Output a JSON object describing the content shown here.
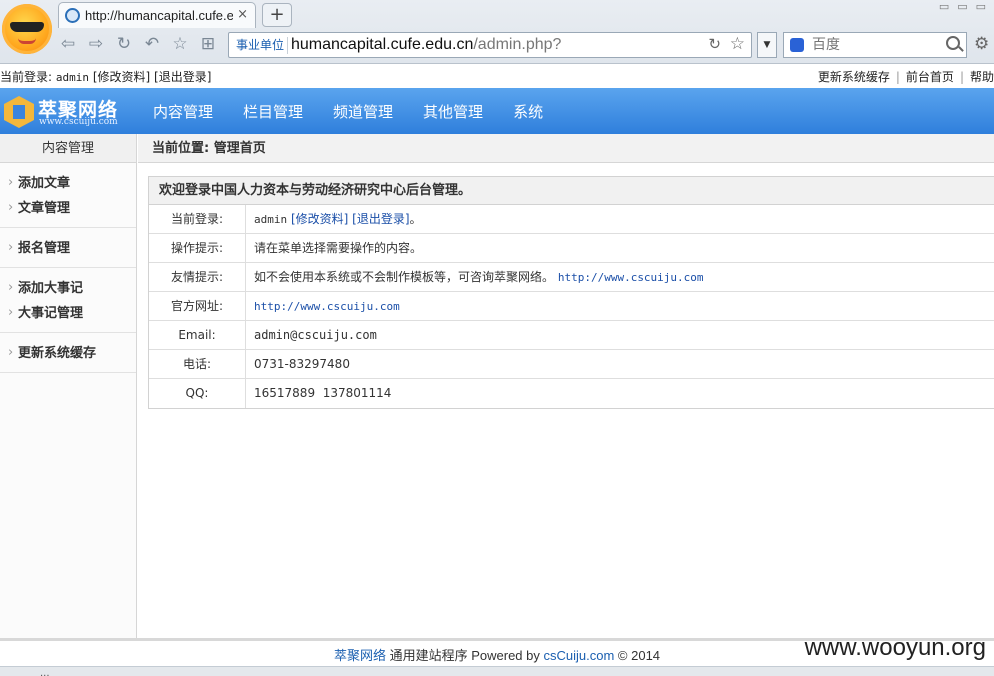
{
  "browser": {
    "tab_title": "http://humancapital.cufe.e",
    "tab_close": "×",
    "new_tab": "+",
    "address_badge": "事业单位",
    "url_host": "humancapital.cufe.edu.cn",
    "url_path": "/admin.php?",
    "search_placeholder": "百度",
    "status_text": "..."
  },
  "top_strip": {
    "login_prefix": "当前登录:",
    "login_user": "admin",
    "edit_profile": "[修改资料]",
    "logout": "[退出登录]",
    "links": [
      "更新系统缓存",
      "前台首页",
      "帮助"
    ],
    "separator": "|"
  },
  "header": {
    "brand_name": "萃聚网络",
    "brand_url": "www.cscuiju.com",
    "nav": [
      "内容管理",
      "栏目管理",
      "频道管理",
      "其他管理",
      "系统"
    ]
  },
  "sidebar": {
    "title": "内容管理",
    "groups": [
      [
        "添加文章",
        "文章管理"
      ],
      [
        "报名管理"
      ],
      [
        "添加大事记",
        "大事记管理"
      ],
      [
        "更新系统缓存"
      ]
    ]
  },
  "main": {
    "location_label": "当前位置:",
    "location_value": "管理首页",
    "panel_title": "欢迎登录中国人力资本与劳动经济研究中心后台管理。",
    "rows": {
      "login_label": "当前登录:",
      "login_user": "admin",
      "login_edit": "[修改资料]",
      "login_logout": "[退出登录]",
      "login_end": "。",
      "hint_label": "操作提示:",
      "hint_value": "请在菜单选择需要操作的内容。",
      "tip_label": "友情提示:",
      "tip_value": "如不会使用本系统或不会制作模板等，可咨询萃聚网络。",
      "tip_link": "http://www.cscuiju.com",
      "site_label": "官方网址:",
      "site_value": "http://www.cscuiju.com",
      "email_label": "Email:",
      "email_value": "admin@cscuiju.com",
      "phone_label": "电话:",
      "phone_value": "0731-83297480",
      "qq_label": "QQ:",
      "qq_value": "16517889  137801114"
    }
  },
  "footer": {
    "brand_link": "萃聚网络",
    "program": "通用建站程序",
    "powered_by": "Powered by",
    "powered_link": "csCuiju.com",
    "copyright": "© 2014",
    "watermark": "www.wooyun.org"
  },
  "colors": {
    "header_top": "#5aa4ee",
    "header_bottom": "#2f7fdc",
    "link": "#1b4fa8",
    "brand_mark": "#f4b73b"
  }
}
